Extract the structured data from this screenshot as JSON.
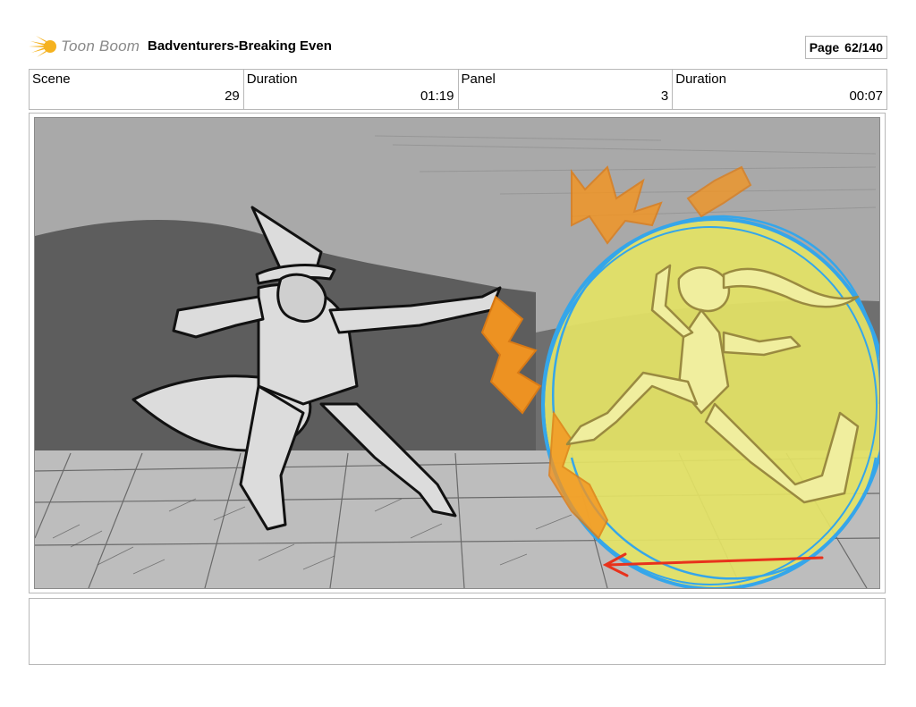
{
  "brand": {
    "name": "Toon Boom",
    "icon": "sun-burst-logo-icon",
    "accent": "#f5b21f"
  },
  "document": {
    "title": "Badventurers-Breaking Even"
  },
  "page": {
    "label": "Page",
    "number": "62/140"
  },
  "info": {
    "scene_label": "Scene",
    "scene_value": "29",
    "scene_duration_label": "Duration",
    "scene_duration_value": "01:19",
    "panel_label": "Panel",
    "panel_value": "3",
    "panel_duration_label": "Duration",
    "panel_duration_value": "00:07"
  },
  "panel": {
    "image": "storyboard-sketch",
    "colors": {
      "background": "#a8a8a8",
      "sphere": "#e9e866",
      "sphere_outline": "#3aa7e8",
      "fire": "#f5951f",
      "arrow": "#e8321c"
    }
  },
  "notes": {
    "text": ""
  }
}
